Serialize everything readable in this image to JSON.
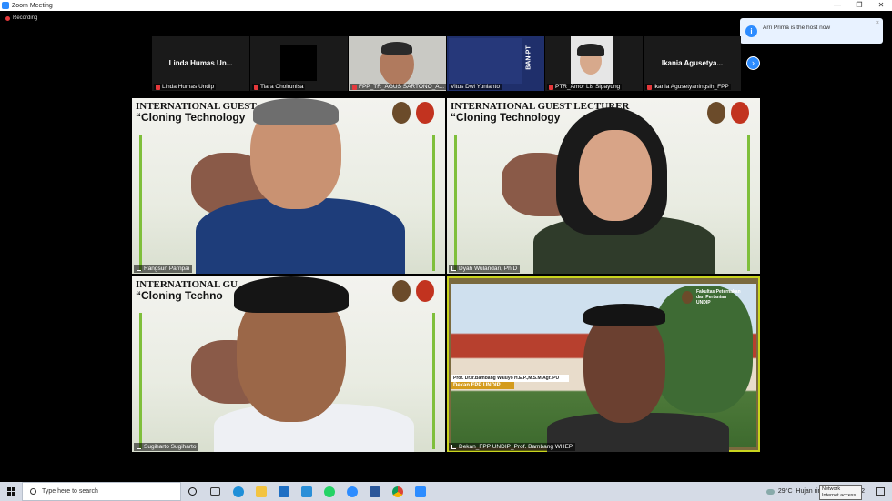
{
  "window": {
    "title": "Zoom Meeting",
    "controls": [
      "—",
      "❐",
      "✕"
    ]
  },
  "recording": {
    "label": "Recording"
  },
  "notification": {
    "text": "Arri Prima is the host now",
    "close": "×"
  },
  "thumbnails": [
    {
      "name": "Linda Humas Un...",
      "label": "Linda Humas Undip",
      "muted": true
    },
    {
      "name": "",
      "label": "Tiara Choirunisa",
      "muted": true
    },
    {
      "name": "",
      "label": "FPP_TR_AGUS SARTONO_A...",
      "muted": true
    },
    {
      "name": "",
      "label": "Vitus Dwi Yunianto",
      "muted": false,
      "side_text": "BAN-PT"
    },
    {
      "name": "",
      "label": "PTR_Amor Lis Sipayung",
      "muted": true
    },
    {
      "name": "Ikania Agusetya...",
      "label": "Ikania Agusetyaningsih_FPP",
      "muted": true
    }
  ],
  "next_page": "›",
  "slide": {
    "title": "INTERNATIONAL GUEST LECTURER",
    "subtitle": "“Cloning Technology",
    "title_short": "INTERNATIONAL GU",
    "subtitle_short": "“Cloning Techno",
    "title_left": "INTERNATIONAL GUEST"
  },
  "speakers": [
    {
      "label": "Rangsun Parnpai"
    },
    {
      "label": "Dyah Wulandari, Ph.D"
    },
    {
      "label": "Sugiharto Sugiharto"
    },
    {
      "label": "Dekan_FPP UNDIP_Prof. Bambang WHEP"
    }
  ],
  "dean_tile": {
    "banner_name": "Prof. Dr.Ir.Bambang Waluyo H.E.P.,M.S.M.Agr.IPU",
    "banner_role": "Dekan FPP UNDIP",
    "faculty": "Fakultas Peternakan\ndan Pertanian\nUNDIP"
  },
  "taskbar": {
    "search_placeholder": "Type here to search",
    "weather": "29°C  Hujan ringan",
    "network_tip": "Network\nInternet access",
    "time_fragment": "2",
    "icons": [
      "task-view-icon",
      "edge-icon",
      "file-explorer-icon",
      "mail-icon",
      "l-app-icon",
      "whatsapp-icon",
      "zoom-icon",
      "word-icon",
      "chrome-icon",
      "zoom-meeting-icon"
    ]
  },
  "colors": {
    "accent": "#2d8cff",
    "mute": "#e5383b",
    "active_speaker": "#c9d41e"
  }
}
